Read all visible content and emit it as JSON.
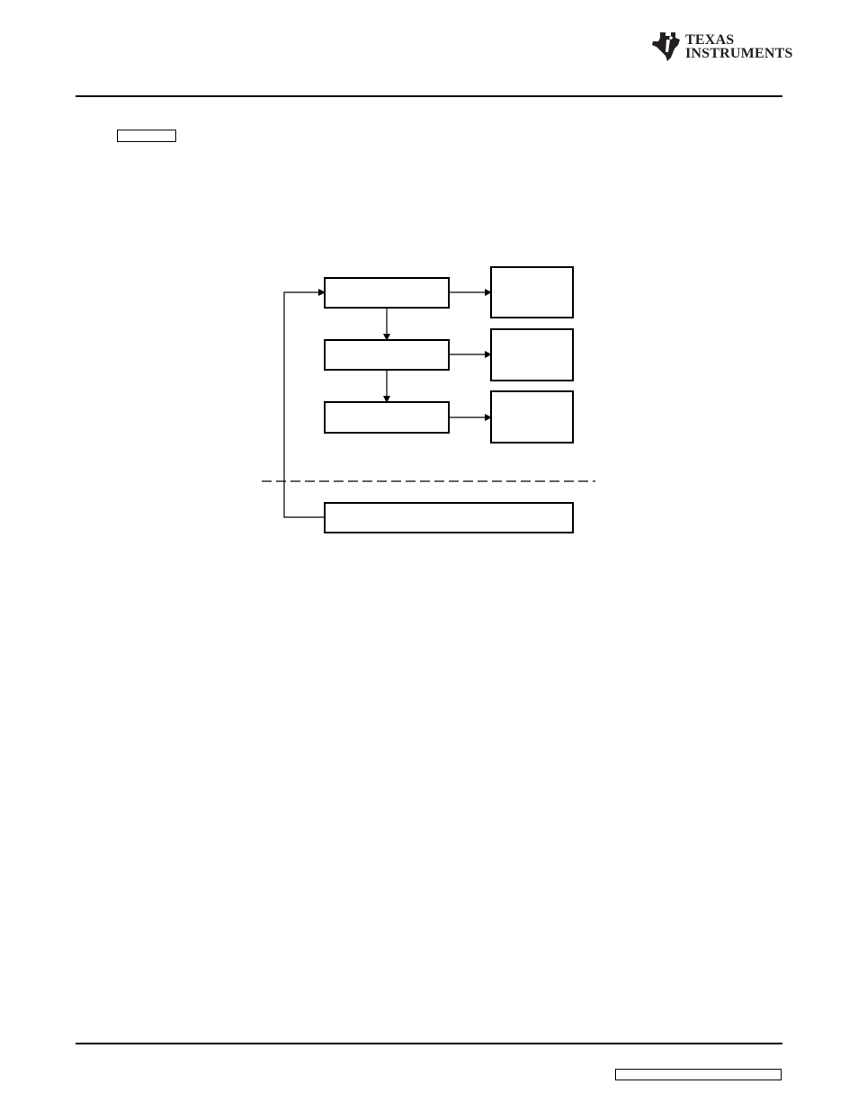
{
  "header": {
    "brand_line1": "Texas",
    "brand_line2": "Instruments",
    "logo_icon": "ti-logo-icon"
  },
  "section_tag": {
    "text": ""
  },
  "diagram": {
    "stages": [
      {
        "label": ""
      },
      {
        "label": ""
      },
      {
        "label": ""
      }
    ],
    "outputs": [
      {
        "label": ""
      },
      {
        "label": ""
      },
      {
        "label": ""
      }
    ],
    "feedback_block": {
      "label": ""
    },
    "divider": "dashed"
  },
  "footer": {
    "doc_id": ""
  },
  "colors": {
    "ink": "#000000",
    "logo": "#231f20",
    "background": "#ffffff"
  }
}
